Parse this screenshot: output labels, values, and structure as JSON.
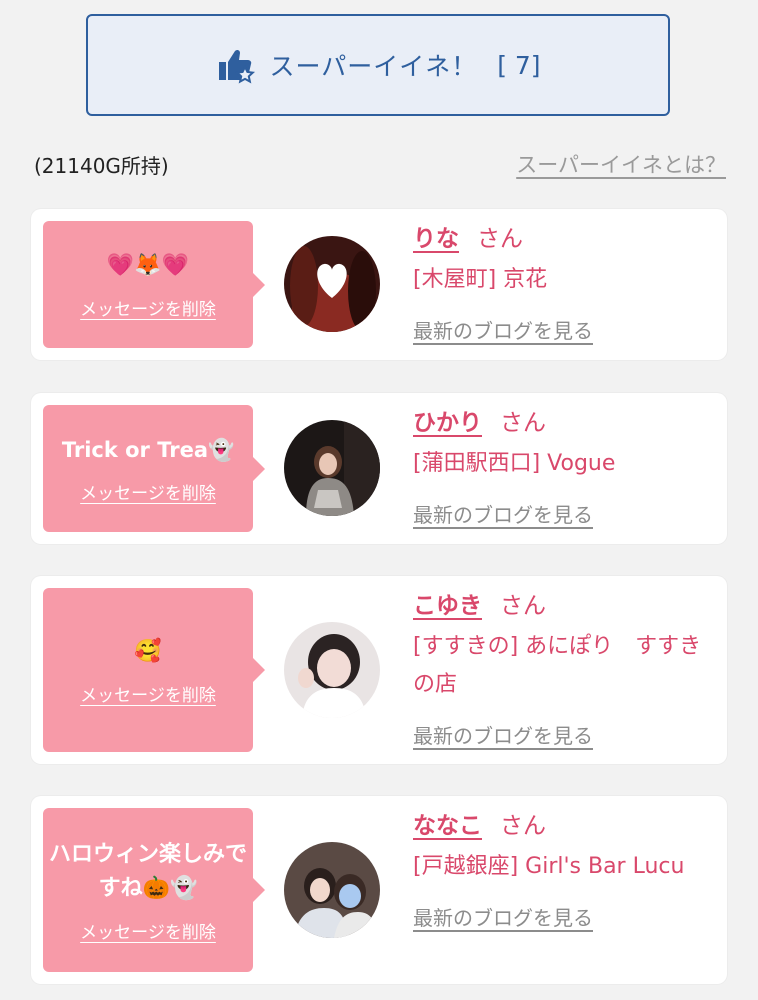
{
  "super_like": {
    "label": "スーパーイイネ！",
    "count": "[ 7]"
  },
  "gold_owned": "(21140G所持)",
  "about_link": "スーパーイイネとは？",
  "delete_label": "メッセージを削除",
  "blog_label": "最新のブログを見る",
  "san_label": "さん",
  "cards": [
    {
      "message": "💗🦊💗",
      "name": "りな",
      "shop": "[木屋町] 京花"
    },
    {
      "message": "Trick or Trea👻",
      "name": "ひかり",
      "shop": "[蒲田駅西口] Vogue"
    },
    {
      "message": "🥰",
      "name": "こゆき",
      "shop": "[すすきの] あにぽり　すすきの店"
    },
    {
      "message": "ハロウィン楽しみですね🎃👻",
      "name": "ななこ",
      "shop": "[戸越銀座] Girl's Bar Lucu"
    }
  ],
  "colors": {
    "accent_blue": "#2f5f9e",
    "bubble_pink": "#f79aa8",
    "name_pink": "#d9486b"
  }
}
